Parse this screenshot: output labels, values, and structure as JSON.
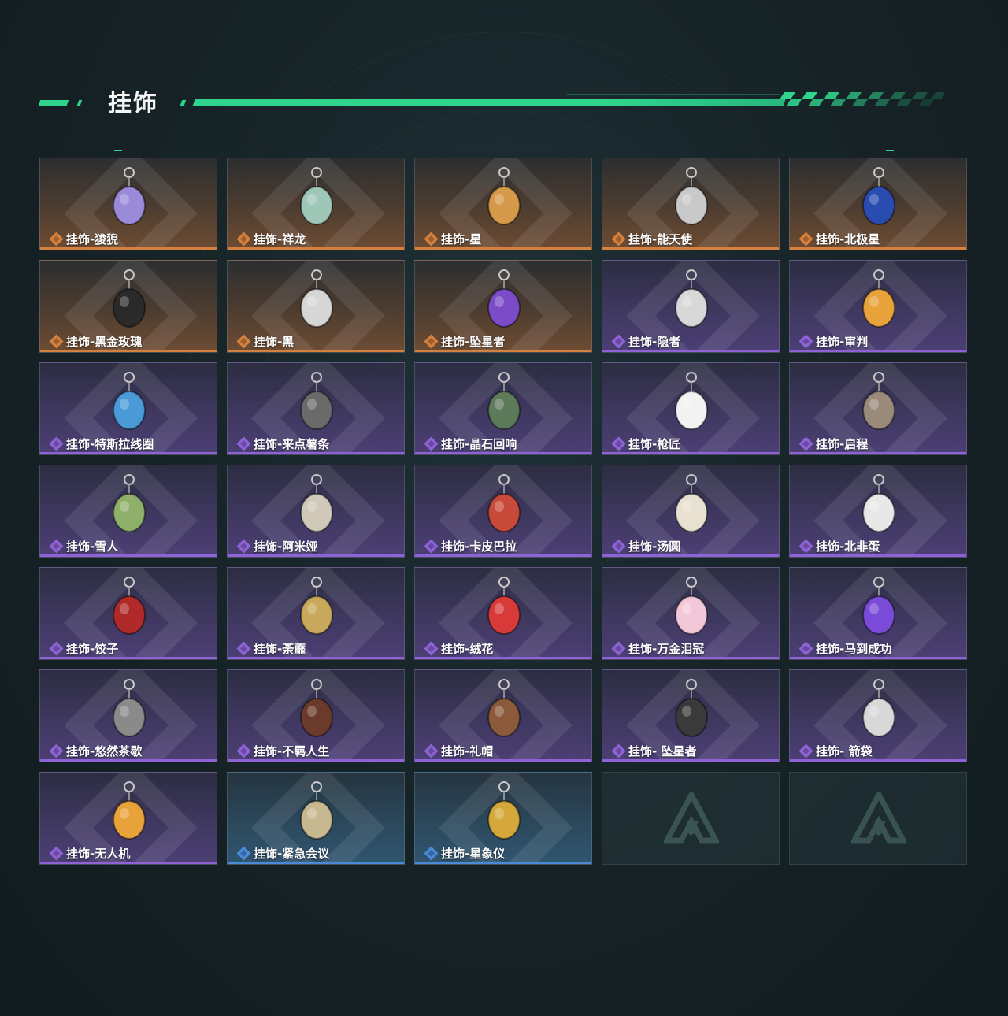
{
  "header": {
    "title": "挂饰",
    "accent_color": "#2fd58d"
  },
  "rarity_colors": {
    "gold": "#d4803e",
    "purple": "#8d63d6",
    "blue": "#4a8ad8"
  },
  "items": [
    {
      "label": "挂饰-狻猊",
      "rarity": "gold",
      "icon": "purple-lion-charm-icon"
    },
    {
      "label": "挂饰-祥龙",
      "rarity": "gold",
      "icon": "jade-dragon-charm-icon"
    },
    {
      "label": "挂饰-星",
      "rarity": "gold",
      "icon": "star-tarot-card-charm-icon"
    },
    {
      "label": "挂饰-能天使",
      "rarity": "gold",
      "icon": "exusiai-tag-charm-icon"
    },
    {
      "label": "挂饰-北极星",
      "rarity": "gold",
      "icon": "blue-crystal-charm-icon"
    },
    {
      "label": "挂饰-黑金玫瑰",
      "rarity": "gold",
      "icon": "black-gold-rose-charm-icon"
    },
    {
      "label": "挂饰-黑",
      "rarity": "gold",
      "icon": "black-tag-charm-icon"
    },
    {
      "label": "挂饰-坠星者",
      "rarity": "gold",
      "icon": "purple-crystal-charm-icon"
    },
    {
      "label": "挂饰-隐者",
      "rarity": "purple",
      "icon": "hermit-tarot-card-charm-icon"
    },
    {
      "label": "挂饰-审判",
      "rarity": "purple",
      "icon": "judgement-tarot-card-charm-icon"
    },
    {
      "label": "挂饰-特斯拉线圈",
      "rarity": "purple",
      "icon": "tesla-coil-charm-icon"
    },
    {
      "label": "挂饰-来点薯条",
      "rarity": "purple",
      "icon": "french-fries-charm-icon"
    },
    {
      "label": "挂饰-晶石回响",
      "rarity": "purple",
      "icon": "crystal-echo-charm-icon"
    },
    {
      "label": "挂饰-枪匠",
      "rarity": "purple",
      "icon": "gunsmith-charm-icon"
    },
    {
      "label": "挂饰-启程",
      "rarity": "purple",
      "icon": "departure-emblem-charm-icon"
    },
    {
      "label": "挂饰-雪人",
      "rarity": "purple",
      "icon": "snowman-charm-icon"
    },
    {
      "label": "挂饰-阿米娅",
      "rarity": "purple",
      "icon": "amiya-charm-icon"
    },
    {
      "label": "挂饰-卡皮巴拉",
      "rarity": "purple",
      "icon": "capybara-charm-icon"
    },
    {
      "label": "挂饰-汤圆",
      "rarity": "purple",
      "icon": "tangyuan-bowl-charm-icon"
    },
    {
      "label": "挂饰-北非蛋",
      "rarity": "purple",
      "icon": "shakshuka-charm-icon"
    },
    {
      "label": "挂饰-饺子",
      "rarity": "purple",
      "icon": "dumpling-plate-charm-icon"
    },
    {
      "label": "挂饰-荼蘼",
      "rarity": "purple",
      "icon": "white-flower-charm-icon"
    },
    {
      "label": "挂饰-绒花",
      "rarity": "purple",
      "icon": "red-velvet-flower-charm-icon"
    },
    {
      "label": "挂饰-万金泪冠",
      "rarity": "purple",
      "icon": "golden-crown-charm-icon"
    },
    {
      "label": "挂饰-马到成功",
      "rarity": "purple",
      "icon": "red-horse-charm-icon"
    },
    {
      "label": "挂饰-悠然茶歇",
      "rarity": "purple",
      "icon": "cupcake-charm-icon"
    },
    {
      "label": "挂饰-不羁人生",
      "rarity": "purple",
      "icon": "purple-sneaker-charm-icon"
    },
    {
      "label": "挂饰-礼帽",
      "rarity": "purple",
      "icon": "fedora-hat-charm-icon"
    },
    {
      "label": "挂饰- 坠星者",
      "rarity": "purple",
      "icon": "triangle-badge-charm-icon"
    },
    {
      "label": "挂饰- 箭袋",
      "rarity": "purple",
      "icon": "quiver-charm-icon"
    },
    {
      "label": "挂饰-无人机",
      "rarity": "purple",
      "icon": "drone-wheels-charm-icon"
    },
    {
      "label": "挂饰-紧急会议",
      "rarity": "blue",
      "icon": "emergency-meeting-charm-icon"
    },
    {
      "label": "挂饰-星象仪",
      "rarity": "blue",
      "icon": "astrolabe-charm-icon"
    },
    {
      "label": "",
      "rarity": "empty",
      "icon": "game-logo-icon"
    },
    {
      "label": "",
      "rarity": "empty",
      "icon": "game-logo-icon"
    }
  ]
}
